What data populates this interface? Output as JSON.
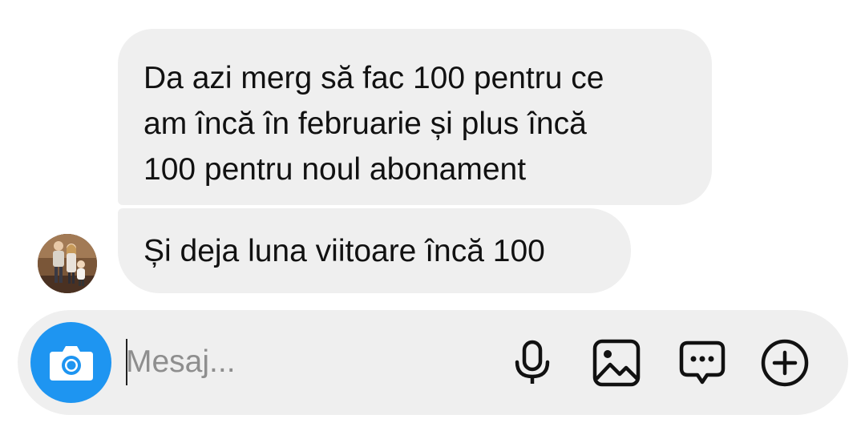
{
  "messages": [
    {
      "sender": "other",
      "lines": [
        "Da azi merg să fac 100 pentru ce",
        "am încă în februarie și plus încă",
        "100 pentru noul abonament"
      ]
    },
    {
      "sender": "other",
      "text": "Și deja luna viitoare încă 100"
    }
  ],
  "avatar": {
    "icon": "user-photo-avatar"
  },
  "composer": {
    "placeholder": "Mesaj...",
    "value": "",
    "camera_icon": "camera-icon",
    "actions": [
      "microphone-icon",
      "gallery-icon",
      "sticker-message-icon",
      "plus-icon"
    ]
  },
  "colors": {
    "bubble_bg": "#efefef",
    "composer_bg": "#efefef",
    "camera_button": "#1e95f1",
    "text": "#111111",
    "placeholder": "#8e8e8e"
  }
}
